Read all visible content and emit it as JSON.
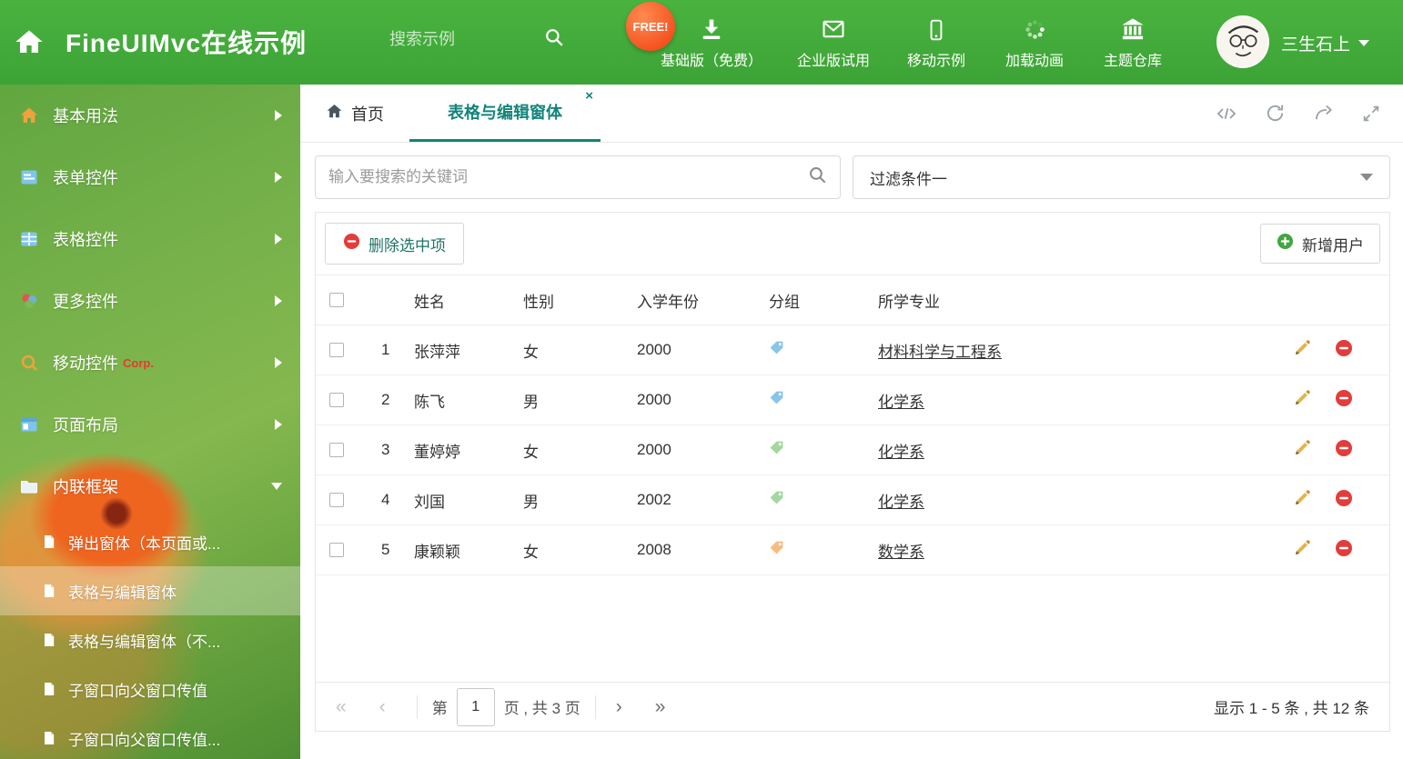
{
  "colors": {
    "header_green": "#3ca336",
    "accent_teal": "#12857a",
    "danger_red": "#e23c3c",
    "success_green": "#43a543",
    "free_badge_orange": "#f4511e",
    "pencil_gold": "#e3b44a"
  },
  "icons": {
    "header_left": "home-icon",
    "header_search": "search-icon",
    "nav": [
      "download-icon",
      "envelope-icon",
      "mobile-icon",
      "spinner-icon",
      "bank-icon"
    ],
    "tab_tools": [
      "code-icon",
      "refresh-icon",
      "forward-icon",
      "expand-icon"
    ]
  },
  "header": {
    "title": "FineUIMvc在线示例",
    "search_placeholder": "搜索示例",
    "free_badge": "FREE!",
    "nav": [
      {
        "label": "基础版（免费）"
      },
      {
        "label": "企业版试用"
      },
      {
        "label": "移动示例"
      },
      {
        "label": "加载动画"
      },
      {
        "label": "主题仓库"
      }
    ],
    "user_name": "三生石上"
  },
  "sidebar": {
    "items": [
      {
        "label": "基本用法"
      },
      {
        "label": "表单控件"
      },
      {
        "label": "表格控件"
      },
      {
        "label": "更多控件"
      },
      {
        "label": "移动控件",
        "badge": "Corp."
      },
      {
        "label": "页面布局"
      },
      {
        "label": "内联框架"
      }
    ],
    "sub_items": [
      {
        "label": "弹出窗体（本页面或..."
      },
      {
        "label": "表格与编辑窗体"
      },
      {
        "label": "表格与编辑窗体（不..."
      },
      {
        "label": "子窗口向父窗口传值"
      },
      {
        "label": "子窗口向父窗口传值..."
      }
    ]
  },
  "tabbar": {
    "tabs": [
      {
        "label": "首页"
      },
      {
        "label": "表格与编辑窗体"
      }
    ]
  },
  "filters": {
    "search_placeholder": "输入要搜索的关键词",
    "filter_value": "过滤条件一"
  },
  "grid": {
    "delete_button": "删除选中项",
    "add_button": "新增用户",
    "columns": {
      "name": "姓名",
      "gender": "性别",
      "year": "入学年份",
      "group": "分组",
      "major": "所学专业"
    },
    "rows": [
      {
        "index": "1",
        "name": "张萍萍",
        "gender": "女",
        "year": "2000",
        "tag_color": "#87c6ea",
        "major": "材料科学与工程系"
      },
      {
        "index": "2",
        "name": "陈飞",
        "gender": "男",
        "year": "2000",
        "tag_color": "#87c6ea",
        "major": "化学系"
      },
      {
        "index": "3",
        "name": "董婷婷",
        "gender": "女",
        "year": "2000",
        "tag_color": "#a3d79f",
        "major": "化学系"
      },
      {
        "index": "4",
        "name": "刘国",
        "gender": "男",
        "year": "2002",
        "tag_color": "#a3d79f",
        "major": "化学系"
      },
      {
        "index": "5",
        "name": "康颖颖",
        "gender": "女",
        "year": "2008",
        "tag_color": "#f6bc80",
        "major": "数学系"
      }
    ]
  },
  "pagination": {
    "prefix": "第",
    "current_page": "1",
    "suffix": "页 , 共 3 页",
    "summary": "显示 1 - 5 条 , 共 12 条"
  }
}
